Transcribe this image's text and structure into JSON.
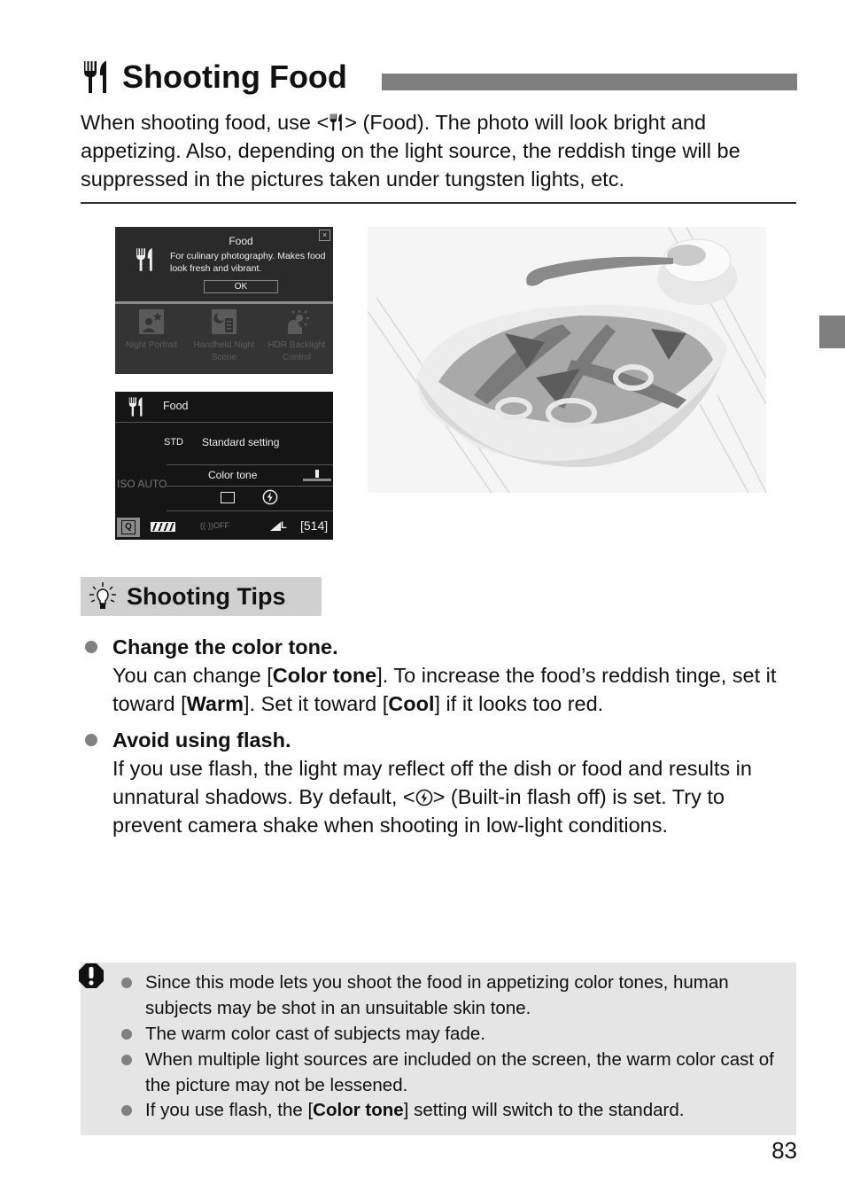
{
  "heading": {
    "icon": "food-icon",
    "title": "Shooting Food"
  },
  "intro": {
    "part1": "When shooting food, use <",
    "icon": "food-icon",
    "part2": "> (Food). The photo will look bright and appetizing. Also, depending on the light source, the reddish tinge will be suppressed in the pictures taken under tungsten lights, etc."
  },
  "screen1": {
    "close_icon": "close-icon",
    "mode_icon": "food-icon",
    "title": "Food",
    "description": "For culinary photography. Makes food look fresh and vibrant.",
    "ok_label": "OK",
    "modes": [
      {
        "icon": "night-portrait-icon",
        "label": "Night Portrait"
      },
      {
        "icon": "handheld-night-scene-icon",
        "label": "Handheld Night Scene"
      },
      {
        "icon": "hdr-backlight-icon",
        "label": "HDR Backlight Control"
      }
    ]
  },
  "screen2": {
    "mode_label": "Food",
    "picture_style_badge": "STD",
    "picture_style_label": "Standard setting",
    "color_tone_label": "Color tone",
    "color_tone_position": 0.5,
    "iso_label": "ISO AUTO",
    "drive_icon": "single-shot-icon",
    "flash_icon": "flash-off-icon",
    "q_label": "Q",
    "battery_icon": "battery-full-icon",
    "wifi_icon": "wifi-off-icon",
    "quality_label": "L",
    "shots_remaining": "[514]"
  },
  "photo": {
    "alt": "Salad with fried strips in a white bowl, spoon and sauce bowl behind"
  },
  "tips": {
    "header_icon": "lightbulb-icon",
    "header": "Shooting Tips",
    "items": [
      {
        "head": "Change the color tone.",
        "t1": "You can change [",
        "b1": "Color tone",
        "t2": "]. To increase the food’s reddish tinge, set it toward [",
        "b2": "Warm",
        "t3": "]. Set it toward [",
        "b3": "Cool",
        "t4": "] if it looks too red."
      },
      {
        "head": "Avoid using flash.",
        "t1": "If you use flash, the light may reflect off the dish or food and results in unnatural shadows. By default, <",
        "icon": "flash-off-icon",
        "t2": "> (Built-in flash off) is set. Try to prevent camera shake when shooting in low-light conditions."
      }
    ]
  },
  "caution": {
    "icon": "caution-icon",
    "items": [
      {
        "text": "Since this mode lets you shoot the food in appetizing color tones, human subjects may be shot in an unsuitable skin tone."
      },
      {
        "text": "The warm color cast of subjects may fade."
      },
      {
        "text": "When multiple light sources are included on the screen, the warm color cast of the picture may not be lessened."
      },
      {
        "t1": "If you use flash, the [",
        "b1": "Color tone",
        "t2": "] setting will switch to the standard."
      }
    ]
  },
  "page_number": "83",
  "colors": {
    "heading_bar": "#7f7f7f",
    "tips_header_bg": "#d0d0d0",
    "caution_bg": "#e5e5e5",
    "bullet": "#808080"
  }
}
